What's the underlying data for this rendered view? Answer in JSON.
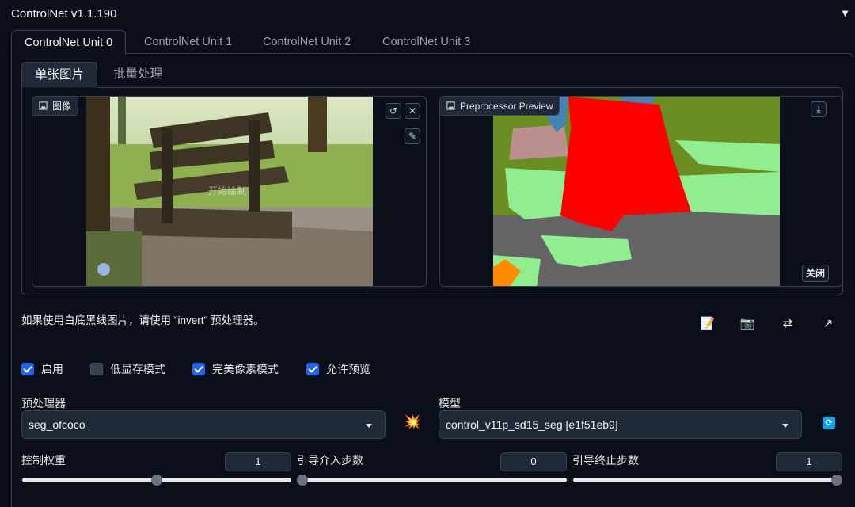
{
  "header": {
    "title": "ControlNet v1.1.190",
    "collapse_icon": "▼"
  },
  "unit_tabs": [
    "ControlNet Unit 0",
    "ControlNet Unit 1",
    "ControlNet Unit 2",
    "ControlNet Unit 3"
  ],
  "image_tabs": [
    "单张图片",
    "批量处理"
  ],
  "image_panel": {
    "label": "图像",
    "canvas_hint": "开始绘制",
    "icons": [
      "undo-icon",
      "close-icon",
      "edit-icon"
    ]
  },
  "preview_panel": {
    "label": "Preprocessor Preview",
    "close_label": "关闭",
    "icons": [
      "download-icon"
    ]
  },
  "hint": "如果使用白底黑线图片，请使用 \"invert\" 预处理器。",
  "tools": [
    "document-icon",
    "camera-icon",
    "swap-icon",
    "send-icon"
  ],
  "checkboxes": [
    {
      "label": "启用",
      "checked": true
    },
    {
      "label": "低显存模式",
      "checked": false
    },
    {
      "label": "完美像素模式",
      "checked": true
    },
    {
      "label": "允许预览",
      "checked": true
    }
  ],
  "preprocessor": {
    "label": "预处理器",
    "value": "seg_ofcoco",
    "run_icon": "explosion-icon"
  },
  "model": {
    "label": "模型",
    "value": "control_v11p_sd15_seg [e1f51eb9]",
    "refresh_icon": "refresh-icon"
  },
  "sliders": [
    {
      "label": "控制权重",
      "value": "1",
      "level": 0.5
    },
    {
      "label": "引导介入步数",
      "value": "0",
      "level": 0.0
    },
    {
      "label": "引导终止步数",
      "value": "1",
      "level": 1.0
    }
  ],
  "colors": {
    "accent": "#2563eb",
    "background": "#0b0f19",
    "panel": "#1f2937",
    "seg_red": "#ff0000",
    "seg_green": "#90ee90",
    "seg_olive": "#6b8e23",
    "seg_gray": "#646464"
  }
}
